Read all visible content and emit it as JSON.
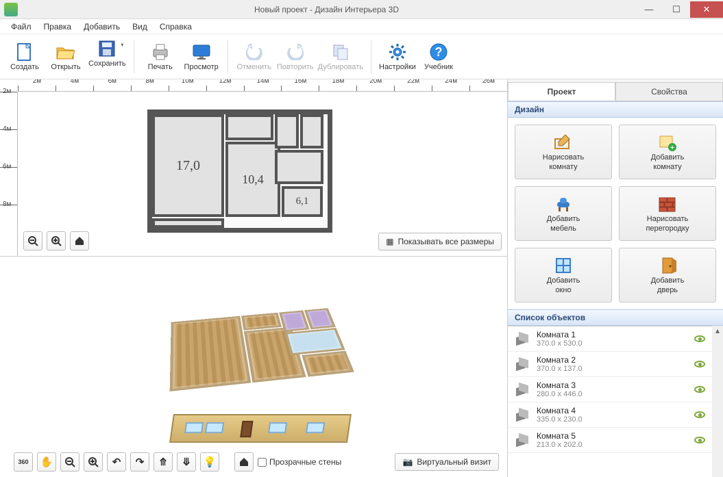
{
  "window": {
    "title": "Новый проект - Дизайн Интерьера 3D"
  },
  "menu": [
    "Файл",
    "Правка",
    "Добавить",
    "Вид",
    "Справка"
  ],
  "toolbar": {
    "create": "Создать",
    "open": "Открыть",
    "save": "Сохранить",
    "print": "Печать",
    "preview": "Просмотр",
    "undo": "Отменить",
    "redo": "Повторить",
    "duplicate": "Дублировать",
    "settings": "Настройки",
    "tutorial": "Учебник"
  },
  "ruler_h": [
    "2м",
    "4м",
    "6м",
    "8м",
    "10м",
    "12м",
    "14м",
    "16м",
    "18м",
    "20м",
    "22м",
    "24м",
    "26м"
  ],
  "ruler_v": [
    "2м",
    "4м",
    "6м",
    "8м"
  ],
  "plan": {
    "room_a": "17,0",
    "room_b": "10,4",
    "room_c": "6,1"
  },
  "pane2d": {
    "show_dims": "Показывать все размеры"
  },
  "pane3d": {
    "label_360": "360",
    "transparent_walls": "Прозрачные стены",
    "virtual_visit": "Виртуальный визит"
  },
  "side": {
    "tab_project": "Проект",
    "tab_props": "Свойства",
    "section_design": "Дизайн",
    "design": {
      "draw_room_1": "Нарисовать",
      "draw_room_2": "комнату",
      "add_room_1": "Добавить",
      "add_room_2": "комнату",
      "add_furn_1": "Добавить",
      "add_furn_2": "мебель",
      "draw_wall_1": "Нарисовать",
      "draw_wall_2": "перегородку",
      "add_win_1": "Добавить",
      "add_win_2": "окно",
      "add_door_1": "Добавить",
      "add_door_2": "дверь"
    },
    "section_objects": "Список объектов",
    "objects": [
      {
        "name": "Комната 1",
        "dim": "370.0 x 530.0"
      },
      {
        "name": "Комната 2",
        "dim": "370.0 x 137.0"
      },
      {
        "name": "Комната 3",
        "dim": "280.0 x 446.0"
      },
      {
        "name": "Комната 4",
        "dim": "335.0 x 230.0"
      },
      {
        "name": "Комната 5",
        "dim": "213.0 x 202.0"
      }
    ]
  }
}
